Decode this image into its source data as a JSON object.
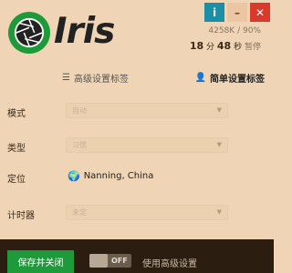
{
  "app": {
    "name": "Iris"
  },
  "window_buttons": {
    "info": "i",
    "minimize": "–",
    "close": "✕"
  },
  "stats": {
    "memory": "4258K",
    "percent": "90%",
    "separator": "/"
  },
  "timer": {
    "minutes": "18",
    "minutes_unit": "分",
    "seconds": "48",
    "seconds_unit": "秒",
    "status": "暂停"
  },
  "tabs": [
    {
      "label": "高级设置标签",
      "icon": "list-icon",
      "active": false
    },
    {
      "label": "简单设置标签",
      "icon": "user-icon",
      "active": true
    }
  ],
  "form": {
    "mode": {
      "label": "模式",
      "value": "自动"
    },
    "type": {
      "label": "类型",
      "value": "习惯"
    },
    "location": {
      "label": "定位",
      "value": "Nanning, China"
    },
    "timer": {
      "label": "计时器",
      "value": "未定"
    }
  },
  "footer": {
    "save_label": "保存并关闭",
    "toggle_state": "OFF",
    "advanced_label": "使用高级设置"
  },
  "colors": {
    "background": "#efd5b5",
    "accent": "#1e9a3a",
    "info": "#1b8fa6",
    "close": "#d93a2b",
    "footer": "#2b1d10"
  }
}
